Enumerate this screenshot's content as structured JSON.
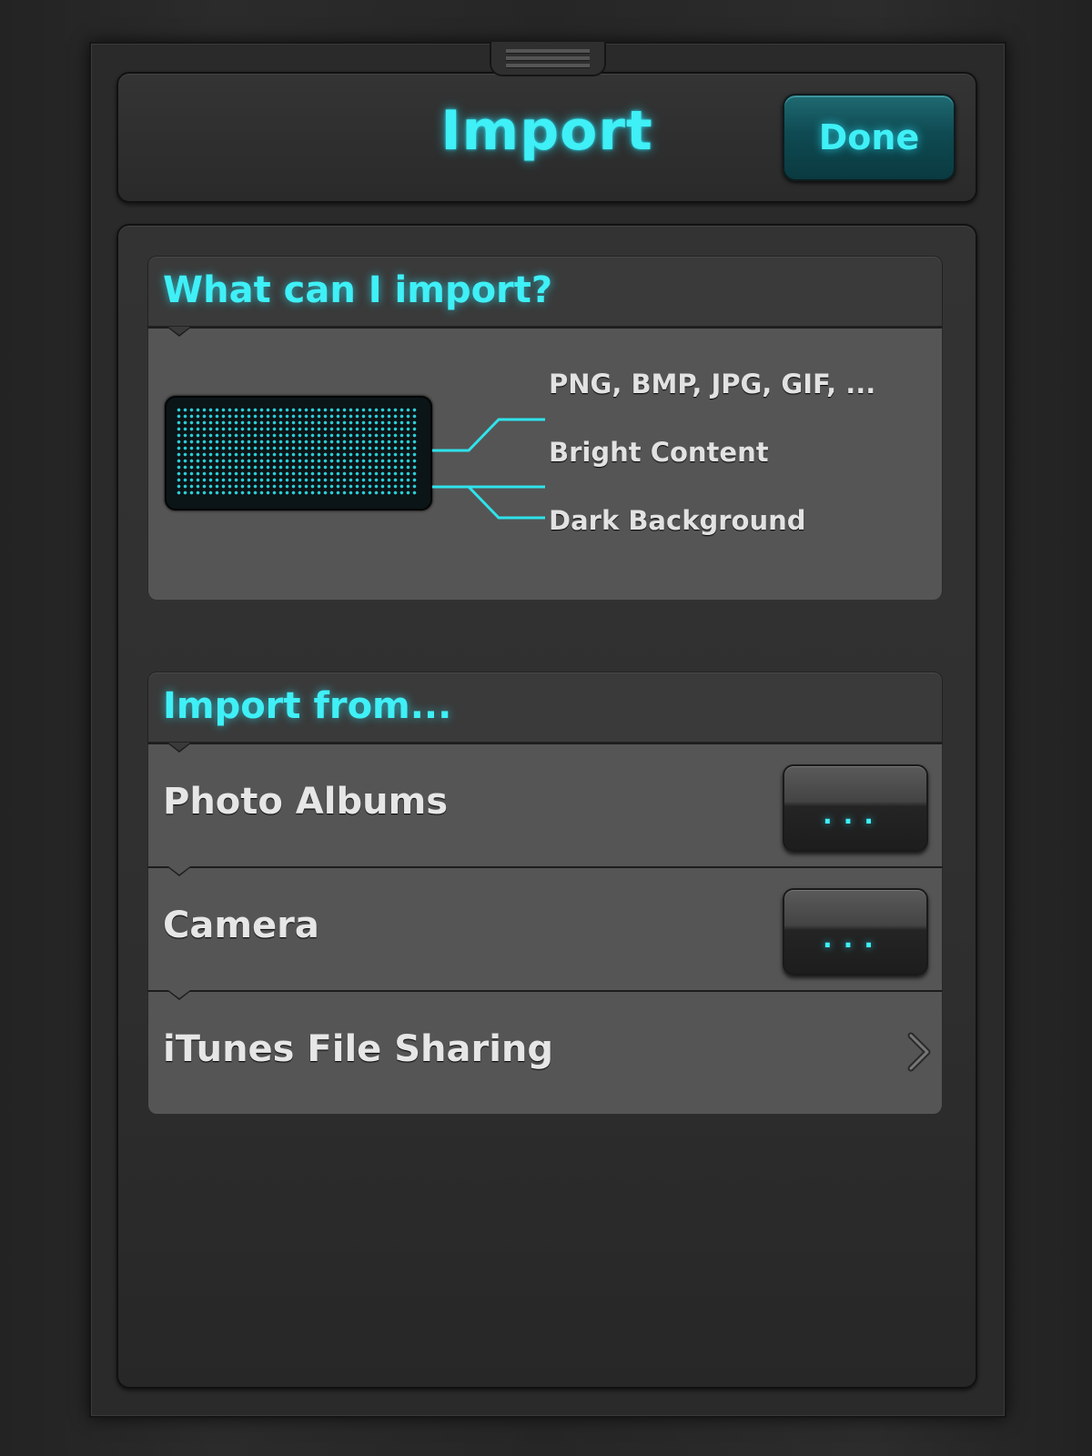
{
  "header": {
    "title": "Import",
    "done_label": "Done"
  },
  "info_section": {
    "title": "What can I import?",
    "requirements": [
      "PNG, BMP, JPG, GIF, ...",
      "Bright Content",
      "Dark Background"
    ]
  },
  "import_section": {
    "title": "Import from...",
    "sources": [
      {
        "label": "Photo Albums",
        "action": "..."
      },
      {
        "label": "Camera",
        "action": "..."
      },
      {
        "label": "iTunes File Sharing",
        "action": "chevron-right-icon"
      }
    ]
  },
  "colors": {
    "accent": "#3ff0f6",
    "background": "#2a2a2a",
    "row": "#555555",
    "text": "#e6e6e6"
  }
}
